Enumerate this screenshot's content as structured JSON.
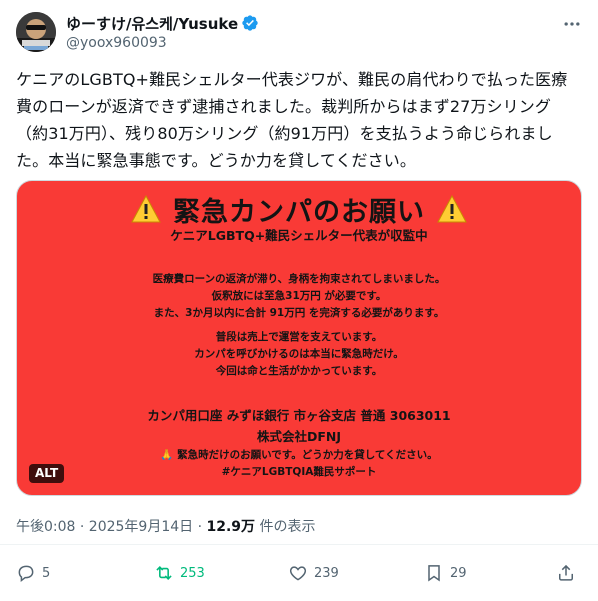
{
  "author": {
    "display_name": "ゆーすけ/유스케/Yusuke",
    "handle": "@yoox960093"
  },
  "tweet": {
    "text": "ケニアのLGBTQ+難民シェルター代表ジワが、難民の肩代わりで払った医療費のローンが返済できず逮捕されました。裁判所からはまず27万シリング（約31万円）、残り80万シリング（約91万円）を支払うよう命じられました。本当に緊急事態です。どうか力を貸してください。"
  },
  "image": {
    "title": "緊急カンパのお願い",
    "subtitle": "ケニアLGBTQ+難民シェルター代表が収監中",
    "block1": [
      "医療費ローンの返済が滞り、身柄を拘束されてしまいました。",
      "仮釈放には至急31万円 が必要です。",
      "また、3か月以内に合計 91万円 を完済する必要があります。"
    ],
    "block2": [
      "普段は売上で運営を支えています。",
      "カンパを呼びかけるのは本当に緊急時だけ。",
      "今回は命と生活がかかっています。"
    ],
    "bank": [
      "カンパ用口座 みずほ銀行 市ヶ谷支店 普通 3063011",
      "株式会社DFNJ"
    ],
    "footer": [
      "🙏 緊急時だけのお願いです。どうか力を貸してください。",
      "#ケニアLGBTQIA難民サポート"
    ],
    "alt_label": "ALT",
    "bg_color": "#f93a36"
  },
  "meta": {
    "time": "午後0:08 · 2025年9月14日 · ",
    "views": "12.9万",
    "views_suffix": " 件の表示"
  },
  "actions": {
    "replies": "5",
    "retweets": "253",
    "likes": "239",
    "bookmarks": "29"
  },
  "colors": {
    "accent": "#1d9bf0",
    "retweet": "#00ba7c",
    "muted": "#536471"
  }
}
